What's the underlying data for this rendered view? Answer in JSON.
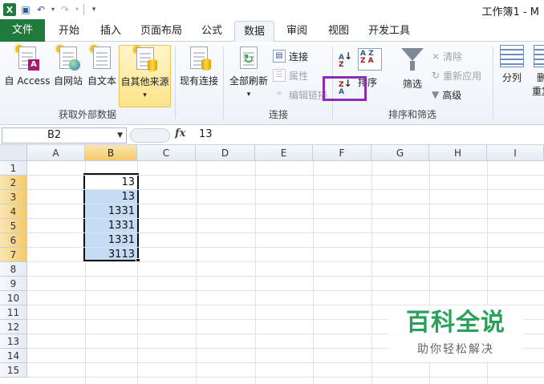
{
  "window": {
    "title": "工作簿1 - M"
  },
  "quick_access": {
    "logo": "X",
    "save_icon": "save-icon",
    "undo_icon": "undo-icon",
    "redo_icon": "redo-icon"
  },
  "tabs": [
    "文件",
    "开始",
    "插入",
    "页面布局",
    "公式",
    "数据",
    "审阅",
    "视图",
    "开发工具"
  ],
  "active_tab": "数据",
  "ribbon": {
    "get_external": {
      "label": "获取外部数据",
      "buttons": [
        "自 Access",
        "自网站",
        "自文本",
        "自其他来源"
      ],
      "dropdown": "▾"
    },
    "existing": "现有连接",
    "connections": {
      "label": "连接",
      "refresh_all": "全部刷新",
      "connect": "连接",
      "properties": "属性",
      "edit_links": "编辑链接"
    },
    "sort_filter": {
      "label": "排序和筛选",
      "sort_az": "A↓Z",
      "sort_za": "Z↓A",
      "sort": "排序",
      "filter": "筛选",
      "clear": "清除",
      "reapply": "重新应用",
      "advanced": "高级"
    },
    "data_tools": {
      "split": "分列",
      "remove": "删",
      "remove2": "重复"
    }
  },
  "formula_bar": {
    "name_box": "B2",
    "fx": "fx",
    "value": "13"
  },
  "columns": [
    "A",
    "B",
    "C",
    "D",
    "E",
    "F",
    "G",
    "H",
    "I"
  ],
  "rows": [
    "1",
    "2",
    "3",
    "4",
    "5",
    "6",
    "7",
    "8",
    "9",
    "10",
    "11",
    "12",
    "13",
    "14",
    "15"
  ],
  "cells_b": [
    "13",
    "13",
    "1331",
    "1331",
    "1331",
    "3113"
  ],
  "watermark": {
    "big": "百科全说",
    "small": "助你轻松解决"
  }
}
